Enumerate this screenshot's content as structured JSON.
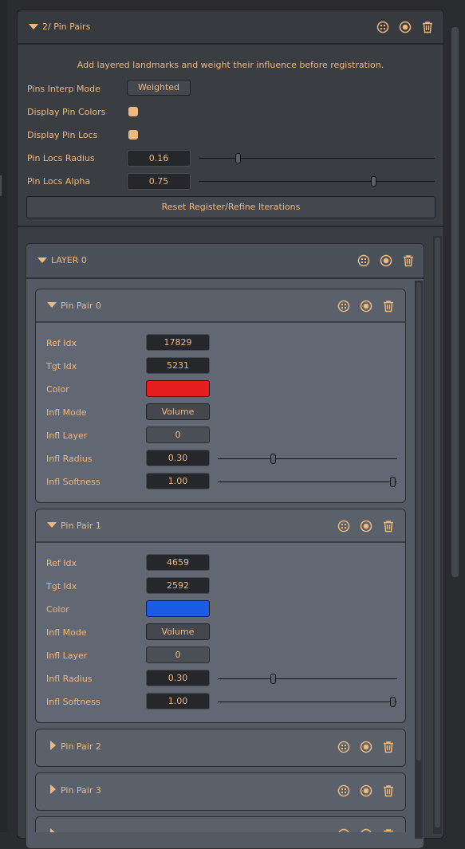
{
  "panel": {
    "title": "2/ Pin Pairs",
    "description": "Add layered landmarks and weight their influence before registration.",
    "interp_mode_label": "Pins Interp Mode",
    "interp_mode_value": "Weighted",
    "display_pin_colors_label": "Display Pin Colors",
    "display_pin_colors_checked": true,
    "display_pin_locs_label": "Display Pin Locs",
    "display_pin_locs_checked": true,
    "pin_locs_radius_label": "Pin Locs Radius",
    "pin_locs_radius_value": "0.16",
    "pin_locs_radius_fraction": 0.16,
    "pin_locs_alpha_label": "Pin Locs Alpha",
    "pin_locs_alpha_value": "0.75",
    "pin_locs_alpha_fraction": 0.75,
    "reset_label": "Reset Register/Refine Iterations"
  },
  "layer": {
    "title": "LAYER 0"
  },
  "pin_pairs": [
    {
      "title": "Pin Pair 0",
      "ref_idx_label": "Ref Idx",
      "ref_idx": "17829",
      "tgt_idx_label": "Tgt Idx",
      "tgt_idx": "5231",
      "color_label": "Color",
      "color": "#e41d1d",
      "infl_mode_label": "Infl Mode",
      "infl_mode": "Volume",
      "infl_layer_label": "Infl Layer",
      "infl_layer": "0",
      "infl_radius_label": "Infl Radius",
      "infl_radius": "0.30",
      "infl_radius_fraction": 0.3,
      "infl_softness_label": "Infl Softness",
      "infl_softness": "1.00",
      "infl_softness_fraction": 1.0
    },
    {
      "title": "Pin Pair 1",
      "ref_idx_label": "Ref Idx",
      "ref_idx": "4659",
      "tgt_idx_label": "Tgt Idx",
      "tgt_idx": "2592",
      "color_label": "Color",
      "color": "#1c5be4",
      "infl_mode_label": "Infl Mode",
      "infl_mode": "Volume",
      "infl_layer_label": "Infl Layer",
      "infl_layer": "0",
      "infl_radius_label": "Infl Radius",
      "infl_radius": "0.30",
      "infl_radius_fraction": 0.3,
      "infl_softness_label": "Infl Softness",
      "infl_softness": "1.00",
      "infl_softness_fraction": 1.0
    },
    {
      "title": "Pin Pair 2"
    },
    {
      "title": "Pin Pair 3"
    }
  ],
  "icons": [
    "grid-icon",
    "record-icon",
    "trash-icon",
    "collapse-triangle-icon",
    "expand-triangle-icon"
  ],
  "colors": {
    "accent": "#f1b87d",
    "panel": "#3a3d42",
    "card": "#616873"
  }
}
